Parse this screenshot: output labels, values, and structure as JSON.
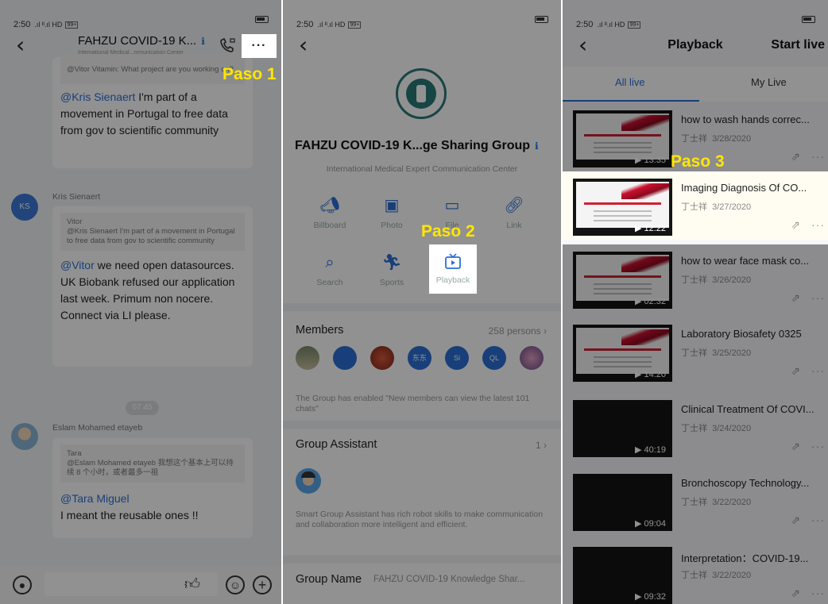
{
  "status": {
    "time": "2:50",
    "signal": ".ıl ᴵᴵ.ıl HD",
    "volte": "99+"
  },
  "annotations": {
    "step1": "Paso 1",
    "step2": "Paso 2",
    "step3": "Paso 3"
  },
  "chat": {
    "title": "FAHZU COVID-19 K...",
    "subtitle": "International Medical...mmunication Center",
    "more_label": "···",
    "messages": [
      {
        "partial_quote": "@Vitor Vitamin: What project are you working on?",
        "mention": "@Kris Sienaert",
        "text": " I'm part of a movement in Portugal to free data from gov to scientific community"
      },
      {
        "sender": "Kris Sienaert",
        "avatar": "KS",
        "quote_name": "Vitor",
        "quote": "@Kris Sienaert I'm part of a movement in Portugal to free data from gov to scientific community",
        "mention": "@Vitor",
        "text": " we need open datasources. UK Biobank refused our application last week. Primum non nocere. Connect via LI please."
      },
      {
        "time": "07:45"
      },
      {
        "sender": "Eslam Mohamed etayeb",
        "quote_name": "Tara",
        "quote": "@Eslam Mohamed etayeb 我想这个基本上可以持续 8 个小时，或者最多一祖",
        "mention": "@Tara Miguel",
        "text": "I meant the reusable ones !!"
      }
    ]
  },
  "group": {
    "title": "FAHZU COVID-19 K...ge Sharing Group",
    "subtitle": "International Medical Expert Communication Center",
    "features": [
      "Billboard",
      "Photo",
      "File",
      "Link",
      "Search",
      "Sports",
      "Playback"
    ],
    "members_label": "Members",
    "members_count": "258 persons",
    "members": [
      "",
      "",
      "",
      "东东",
      "Si",
      "QL",
      ""
    ],
    "notice": "The Group has enabled \"New members can view the latest 101 chats\"",
    "assistant_label": "Group Assistant",
    "assistant_count": "1",
    "assistant_desc": "Smart Group Assistant has rich robot skills to make communication and collaboration more intelligent and efficient.",
    "name_label": "Group Name",
    "name_value": "FAHZU COVID-19 Knowledge Shar..."
  },
  "playback": {
    "title": "Playback",
    "start_live": "Start live",
    "tabs": [
      "All live",
      "My Live"
    ],
    "items": [
      {
        "title": "how to wash hands correc...",
        "author": "丁士祥",
        "date": "3/28/2020",
        "duration": "13:35"
      },
      {
        "title": "Imaging Diagnosis Of  CO...",
        "author": "丁士祥",
        "date": "3/27/2020",
        "duration": "12:22"
      },
      {
        "title": "how to wear face mask co...",
        "author": "丁士祥",
        "date": "3/26/2020",
        "duration": "02:32"
      },
      {
        "title": "Laboratory Biosafety 0325",
        "author": "丁士祥",
        "date": "3/25/2020",
        "duration": "14:20"
      },
      {
        "title": "Clinical Treatment Of COVI...",
        "author": "丁士祥",
        "date": "3/24/2020",
        "duration": "40:19"
      },
      {
        "title": "Bronchoscopy Technology...",
        "author": "丁士祥",
        "date": "3/22/2020",
        "duration": "09:04"
      },
      {
        "title": "Interpretation：COVID-19...",
        "author": "丁士祥",
        "date": "3/22/2020",
        "duration": "09:32"
      }
    ]
  },
  "icons": {
    "back": "chevron-left-icon",
    "call": "phone-video-icon",
    "info": "info-icon",
    "share": "share-icon",
    "more": "more-dots-icon",
    "voice": "microphone-icon",
    "like": "thumbs-up-icon",
    "emoji": "emoji-icon",
    "add": "plus-circle-icon"
  },
  "colors": {
    "accent": "#2b6fd6",
    "callout": "#ffe600",
    "logo": "#2a7a78"
  }
}
